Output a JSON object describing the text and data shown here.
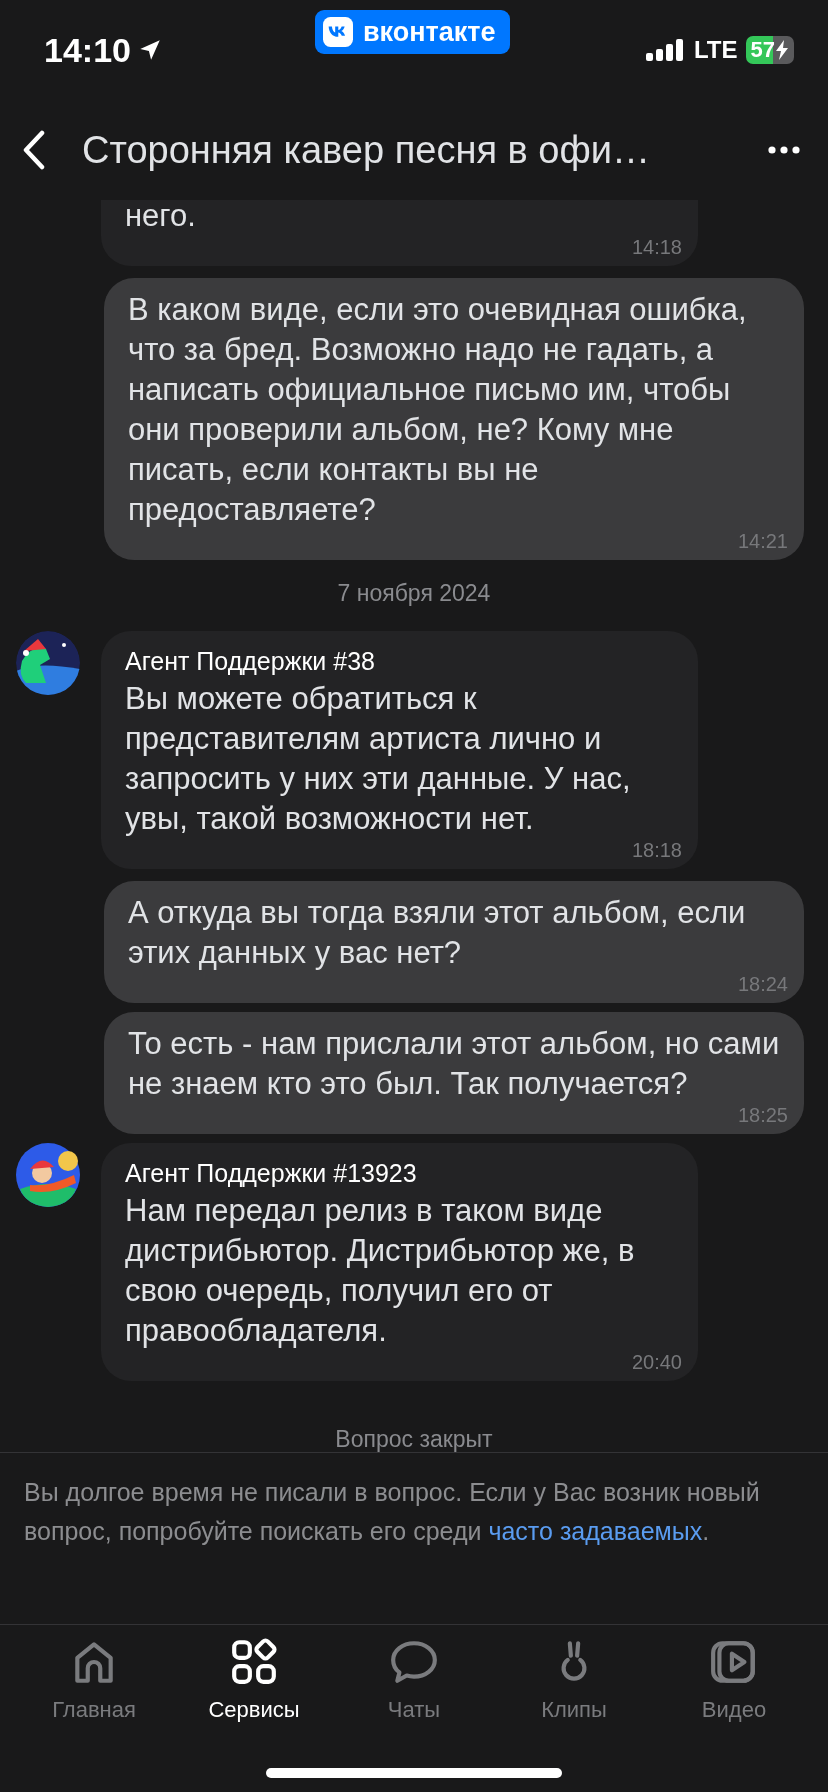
{
  "status_bar": {
    "time": "14:10",
    "app_badge": "вконтакте",
    "network": "LTE",
    "battery": "57"
  },
  "header": {
    "title": "Сторонняя кавер песня в офи…"
  },
  "messages": [
    {
      "kind": "incoming",
      "text": "него.",
      "time": "14:18"
    },
    {
      "kind": "outgoing",
      "text": "В каком виде, если это очевидная ошибка, что за бред. Возможно надо не гадать, а написать официальное письмо им, чтобы они проверили альбом, не? Кому мне писать, если контакты вы не предоставляете?",
      "time": "14:21"
    },
    {
      "kind": "date",
      "text": "7 ноября 2024"
    },
    {
      "kind": "incoming",
      "author": "Агент Поддержки #38",
      "text": "Вы можете обратиться к представителям артиста лично и запросить у них эти данные. У нас, увы, такой возможности нет.",
      "time": "18:18"
    },
    {
      "kind": "outgoing",
      "text": "А откуда вы тогда взяли этот альбом, если этих данных у вас нет?",
      "time": "18:24"
    },
    {
      "kind": "outgoing",
      "text": "То есть - нам прислали этот альбом, но сами не знаем кто это был. Так получается?",
      "time": "18:25"
    },
    {
      "kind": "incoming",
      "author": "Агент Поддержки #13923",
      "text": "Нам передал релиз в таком виде дистрибьютор. Дистрибьютор же, в свою очередь, получил его от правообладателя.",
      "time": "20:40"
    },
    {
      "kind": "status",
      "text": "Вопрос закрыт"
    }
  ],
  "notice": {
    "text": "Вы долгое время не писали в вопрос. Если у Вас возник новый вопрос, попробуйте поискать его среди ",
    "link": "часто задаваемых",
    "suffix": "."
  },
  "nav": [
    {
      "label": "Главная",
      "selected": false
    },
    {
      "label": "Сервисы",
      "selected": true
    },
    {
      "label": "Чаты",
      "selected": false
    },
    {
      "label": "Клипы",
      "selected": false
    },
    {
      "label": "Видео",
      "selected": false
    }
  ]
}
